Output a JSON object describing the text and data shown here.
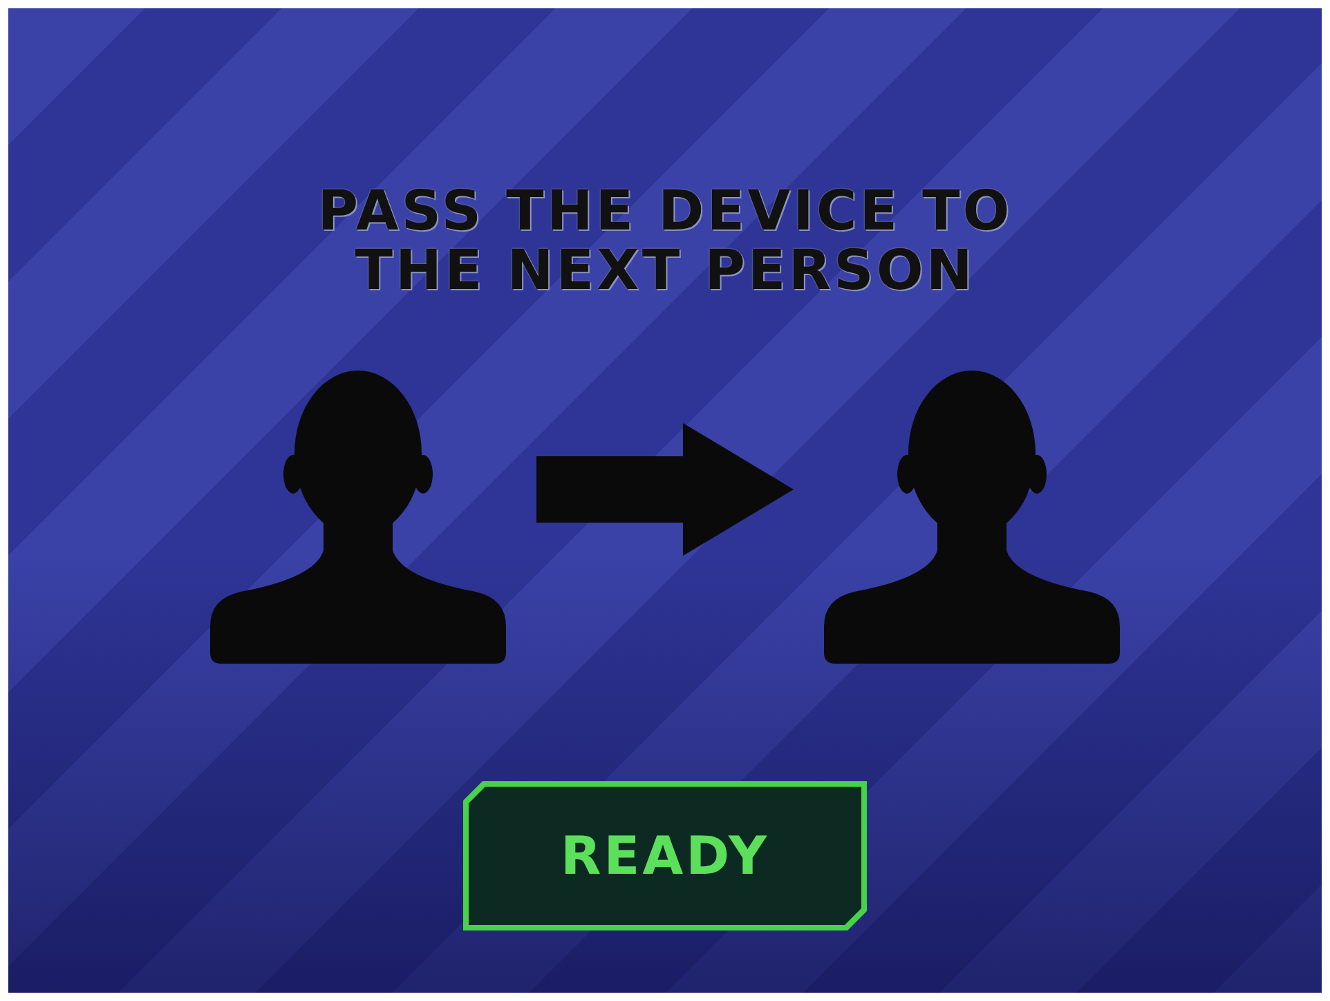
{
  "title": {
    "text": "PASS THE DEVICE TO THE NEXT PERSON"
  },
  "ready_button": {
    "label": "READY"
  }
}
